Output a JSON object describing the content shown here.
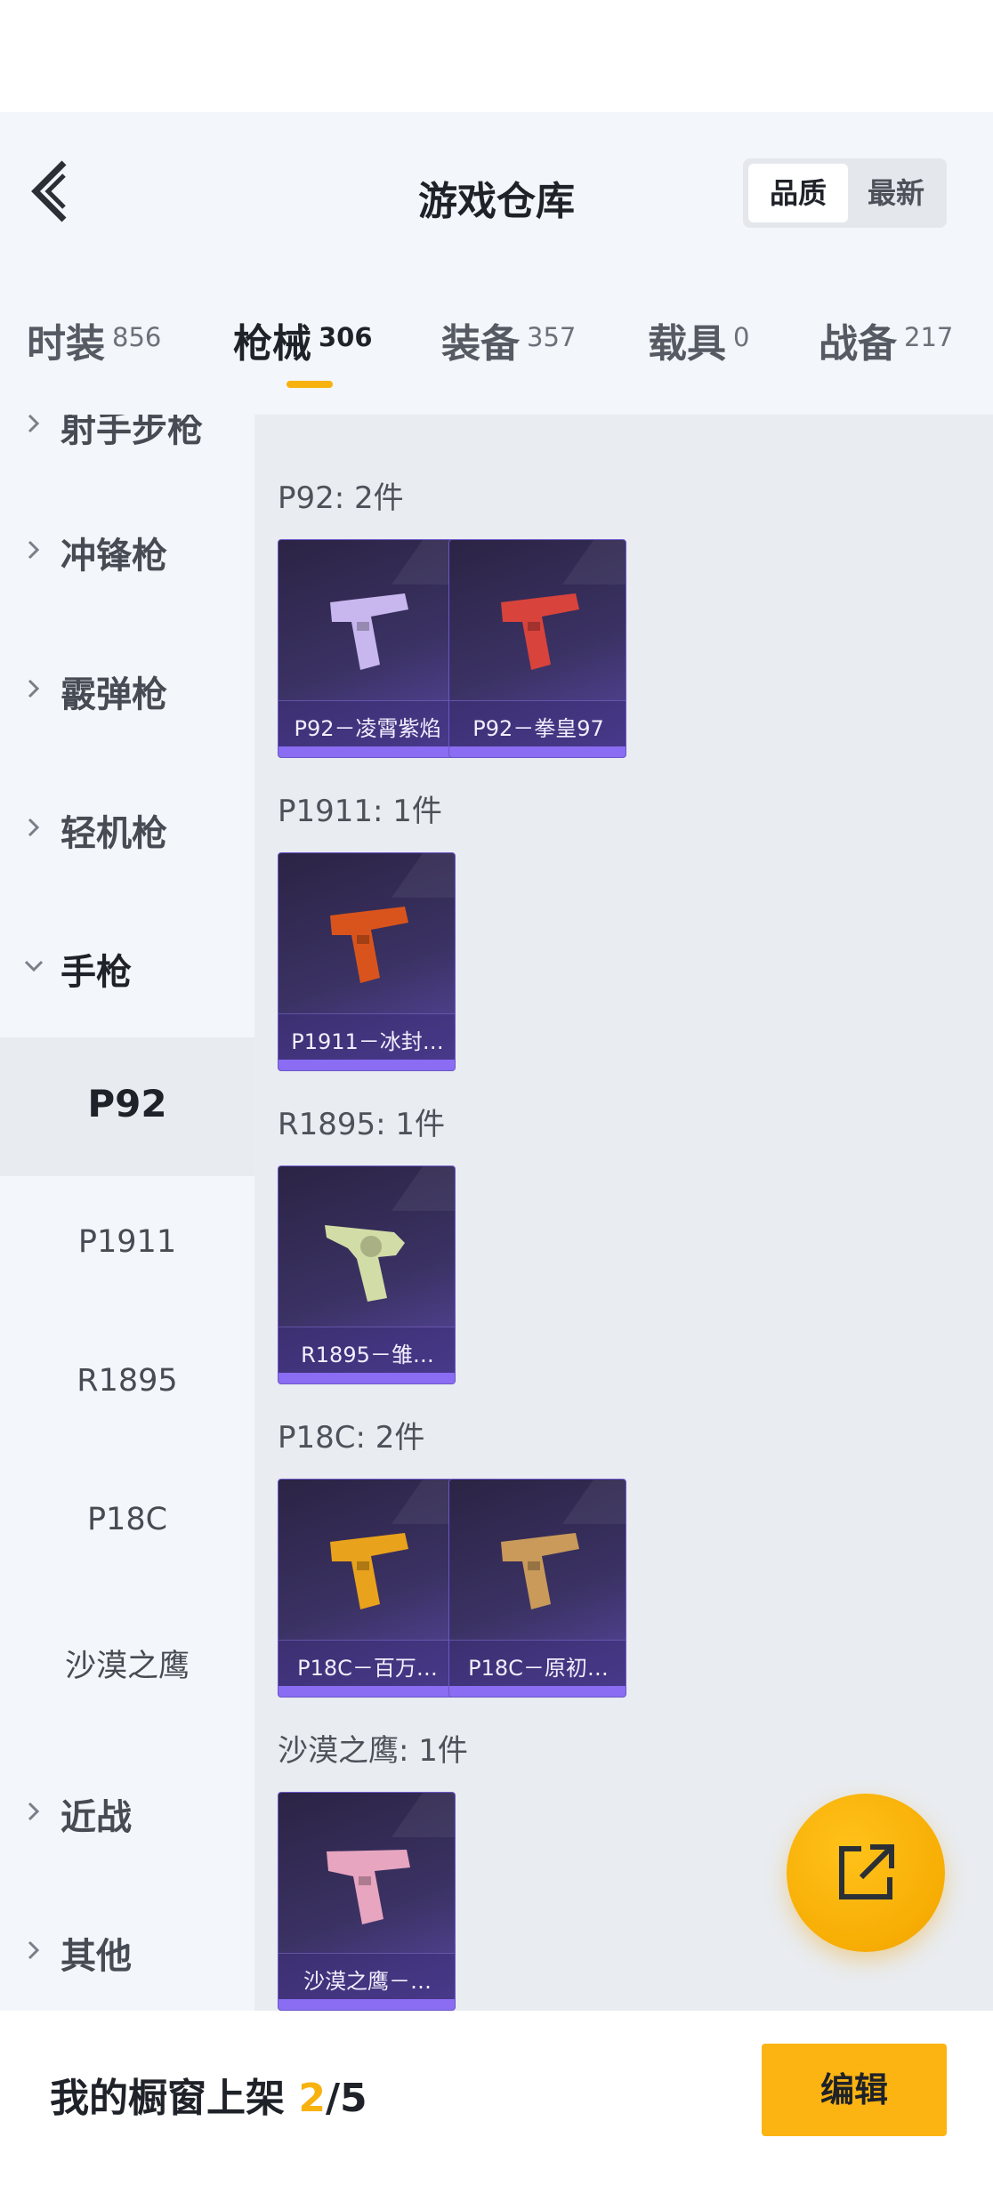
{
  "header": {
    "title": "游戏仓库",
    "sort_options": [
      "品质",
      "最新"
    ],
    "sort_selected": "品质"
  },
  "tabs": [
    {
      "label": "时装",
      "count": "856"
    },
    {
      "label": "枪械",
      "count": "306"
    },
    {
      "label": "装备",
      "count": "357"
    },
    {
      "label": "载具",
      "count": "0"
    },
    {
      "label": "战备",
      "count": "217"
    }
  ],
  "sidebar": {
    "categories": [
      {
        "label": "射手步枪"
      },
      {
        "label": "冲锋枪"
      },
      {
        "label": "霰弹枪"
      },
      {
        "label": "轻机枪"
      },
      {
        "label": "手枪"
      },
      {
        "label": "近战"
      },
      {
        "label": "其他"
      }
    ],
    "pistol_subs": [
      "P92",
      "P1911",
      "R1895",
      "P18C",
      "沙漠之鹰"
    ],
    "selected_sub": "P92"
  },
  "groups": [
    {
      "title": "P92: 2件",
      "items": [
        {
          "name": "P92－凌霄紫焰",
          "color": "#c8b7ee"
        },
        {
          "name": "P92－拳皇97",
          "color": "#d8433c"
        }
      ]
    },
    {
      "title": "P1911: 1件",
      "items": [
        {
          "name": "P1911－冰封…",
          "color": "#d9541c"
        }
      ]
    },
    {
      "title": "R1895: 1件",
      "items": [
        {
          "name": "R1895－雏…",
          "color": "#d2dca6"
        }
      ]
    },
    {
      "title": "P18C: 2件",
      "items": [
        {
          "name": "P18C－百万…",
          "color": "#e9a21c"
        },
        {
          "name": "P18C－原初…",
          "color": "#c99a5a"
        }
      ]
    },
    {
      "title": "沙漠之鹰: 1件",
      "items": [
        {
          "name": "沙漠之鹰－…",
          "color": "#e7a5c0"
        }
      ]
    }
  ],
  "bottom": {
    "shelf_label": "我的橱窗上架",
    "shelf_current": "2",
    "shelf_total": "/5",
    "edit_label": "编辑"
  },
  "colors": {
    "accent": "#f7b20f",
    "card_purple": "#3b3264"
  },
  "icons": [
    "back-arrow-icon",
    "chevron-right-icon",
    "chevron-down-icon",
    "share-external-icon"
  ]
}
